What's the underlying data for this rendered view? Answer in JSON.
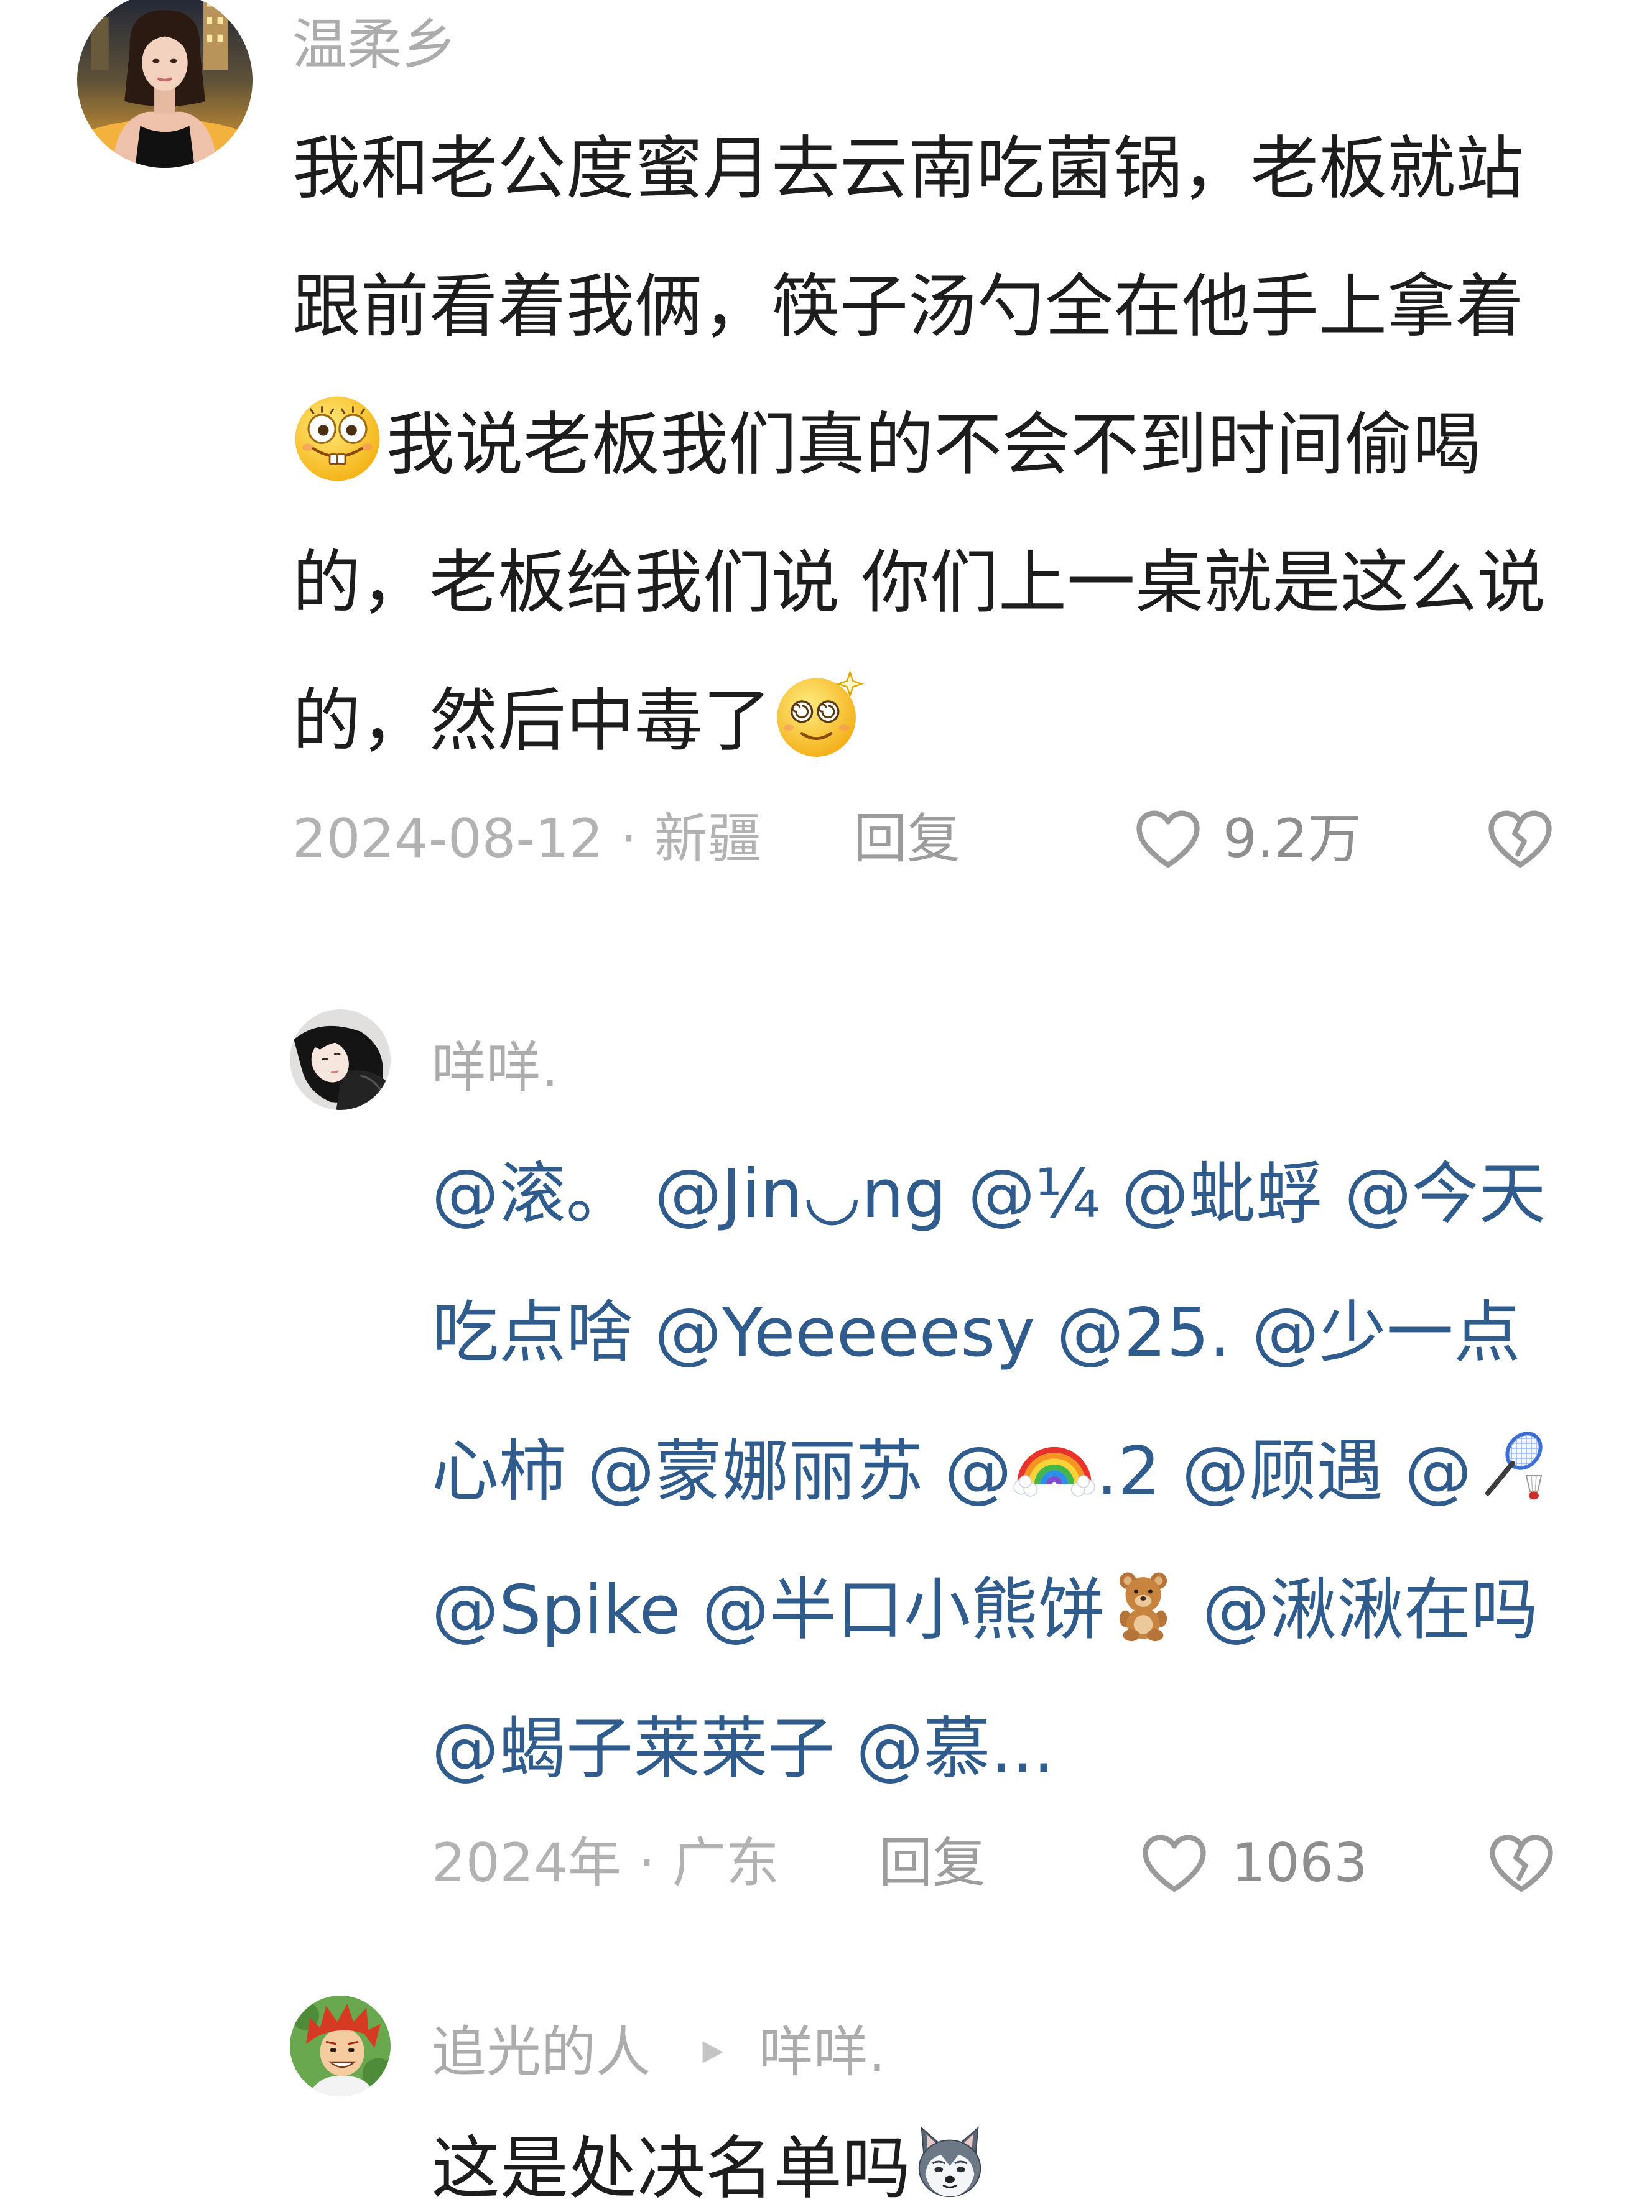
{
  "colors": {
    "background": "#ffffff",
    "comment_text": "#1d1d1d",
    "username": "#acacac",
    "meta": "#b2b2b2",
    "reply_label": "#9c9c9c",
    "like_count": "#8e8e8e",
    "mention": "#2f5c8c",
    "icon_stroke": "#9a9a9a"
  },
  "comment": {
    "avatar_icon": "user-avatar",
    "username": "温柔乡",
    "lines": [
      [
        {
          "text": "我和老公度蜜月去云南吃菌锅，老板就站"
        }
      ],
      [
        {
          "text": "跟前看着我俩，筷子汤勺全在他手上拿着"
        }
      ],
      [
        {
          "icon": "grinning-teeth-emoji"
        },
        {
          "text": "我说老板我们真的不会不到时间偷喝"
        }
      ],
      [
        {
          "text": "的，老板给我们说 你们上一桌就是这么说"
        }
      ],
      [
        {
          "text": "的，然后中毒了"
        },
        {
          "icon": "dizzy-face-emoji"
        }
      ]
    ],
    "date_location": "2024-08-12 · 新疆",
    "reply_label": "回复",
    "like_icon": "heart-outline-icon",
    "like_count": "9.2万",
    "dislike_icon": "broken-heart-icon"
  },
  "reply_1": {
    "avatar_icon": "user-avatar",
    "username": "咩咩.",
    "lines": [
      [
        {
          "text": "@滚。 @Jin◡ng @¼ @蚍蜉 @今天"
        }
      ],
      [
        {
          "text": "吃点啥 @Yeeeeesy @25. @少一点"
        }
      ],
      [
        {
          "text": "心柿 @蒙娜丽苏 @"
        },
        {
          "icon": "rainbow-emoji"
        },
        {
          "text": ".2 @顾遇 @"
        },
        {
          "icon": "badminton-emoji"
        }
      ],
      [
        {
          "text": "@Spike @半口小熊饼"
        },
        {
          "icon": "teddy-bear-emoji"
        },
        {
          "text": " @湫湫在吗"
        }
      ],
      [
        {
          "text": "@蝎子莱莱子 @慕..."
        }
      ]
    ],
    "date_location": "2024年 · 广东",
    "reply_label": "回复",
    "like_icon": "heart-outline-icon",
    "like_count": "1063",
    "dislike_icon": "broken-heart-icon"
  },
  "reply_2": {
    "avatar_icon": "user-avatar",
    "username": "追光的人",
    "reply_arrow_icon": "play-triangle-icon",
    "reply_to": "咩咩.",
    "lines": [
      [
        {
          "text": "这是处决名单吗"
        },
        {
          "icon": "husky-emoji"
        }
      ]
    ]
  }
}
